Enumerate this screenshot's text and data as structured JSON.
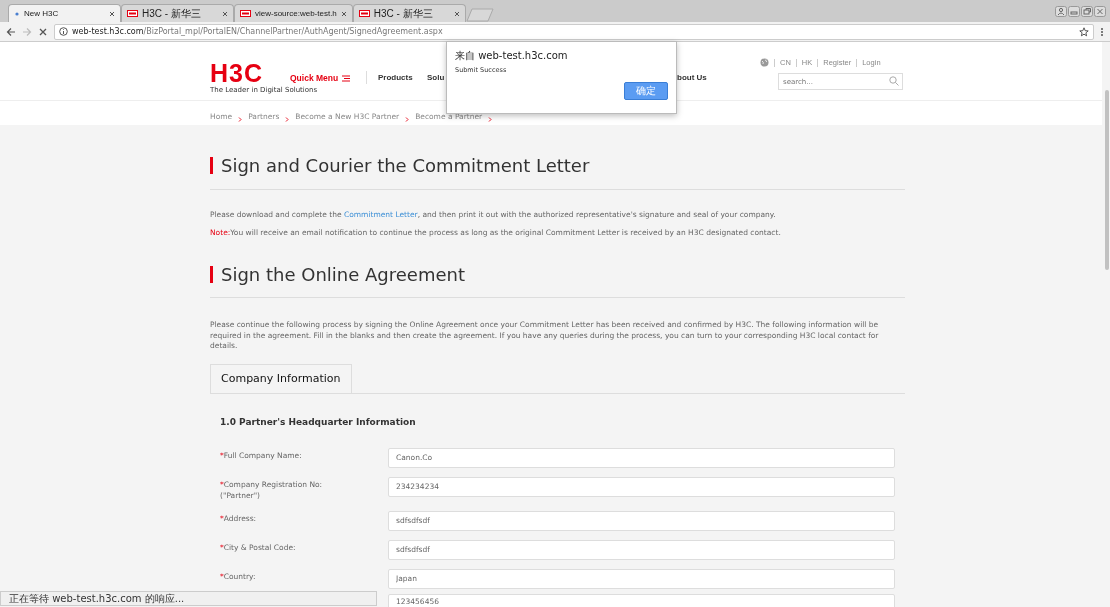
{
  "browser": {
    "tabs": [
      {
        "label": "New H3C",
        "selected": true,
        "kind": "loading"
      },
      {
        "label": "H3C - 新华三",
        "selected": false,
        "kind": "favicon"
      },
      {
        "label": "view-source:web-test.h",
        "selected": false,
        "kind": "favicon"
      },
      {
        "label": "H3C - 新华三",
        "selected": false,
        "kind": "favicon"
      }
    ],
    "address_bar": {
      "host": "web-test.h3c.com",
      "path": "/BizPortal_mpl/PortalEN/ChannelPartner/AuthAgent/SignedAgreement.aspx"
    }
  },
  "header": {
    "logo": {
      "name": "H3C",
      "tagline": "The Leader in Digital Solutions"
    },
    "quick_menu": "Quick Menu",
    "nav": [
      "Products",
      "Solu",
      "bout Us"
    ],
    "top_links": [
      "CN",
      "HK",
      "Register",
      "Login"
    ],
    "search": {
      "placeholder": "search..."
    }
  },
  "breadcrumb": [
    "Home",
    "Partners",
    "Become a New H3C Partner",
    "Become a Partner"
  ],
  "sections": [
    {
      "title": "Sign and Courier the Commitment Letter",
      "paragraphs": [
        [
          {
            "kind": "text",
            "text": "Please download and complete the "
          },
          {
            "kind": "link",
            "text": "Commitment Letter"
          },
          {
            "kind": "text",
            "text": ", and then print it out with the authorized representative's signature and seal of your company."
          }
        ],
        [
          {
            "kind": "note",
            "text": "Note:"
          },
          {
            "kind": "text",
            "text": "You will receive an email notification to continue the process as long as the original Commitment Letter is received by an H3C designated contact."
          }
        ]
      ]
    },
    {
      "title": "Sign the Online Agreement",
      "paragraphs": [
        [
          {
            "kind": "text",
            "text": "Please continue the following process by signing the Online Agreement once your Commitment Letter has been received and confirmed by H3C. The following information will be required in the agreement. Fill in the blanks and then create the agreement. If you have any queries during the process, you can turn to your corresponding H3C local contact for details."
          }
        ]
      ]
    }
  ],
  "form": {
    "tabs": [
      {
        "label": "Company Information",
        "selected": true
      }
    ],
    "subtitle": "1.0 Partner's Headquarter Information",
    "required_mark": "*",
    "fields": [
      {
        "label": "Full Company Name:",
        "required": true,
        "value": "Canon.Co"
      },
      {
        "label": "Company Registration No: (\"Partner\")",
        "required": true,
        "value": "234234234"
      },
      {
        "label": "Address:",
        "required": true,
        "value": "sdfsdfsdf"
      },
      {
        "label": "City & Postal Code:",
        "required": true,
        "value": "sdfsdfsdf"
      },
      {
        "label": "Country:",
        "required": true,
        "value": "Japan"
      },
      {
        "value": "123456456"
      }
    ]
  },
  "dialog": {
    "title": "来自 web-test.h3c.com",
    "message": "Submit Success",
    "button": "确定"
  },
  "status_bar": "正在等待 web-test.h3c.com 的响应..."
}
